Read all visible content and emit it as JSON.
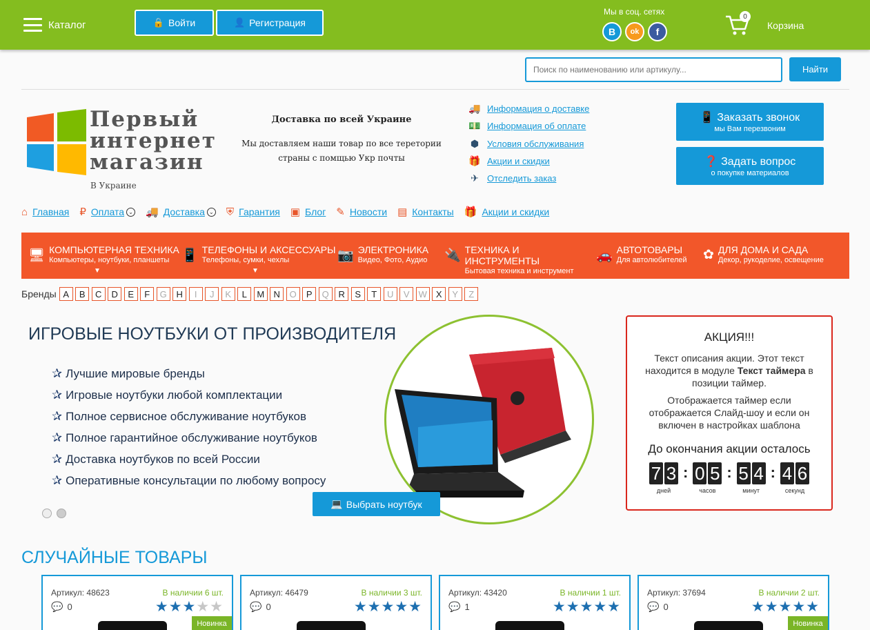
{
  "header": {
    "catalog_label": "Каталог",
    "login_label": "Войти",
    "register_label": "Регистрация",
    "social_label": "Мы в соц. сетях",
    "social": [
      {
        "name": "vk",
        "glyph": "B",
        "color": "#1599d8"
      },
      {
        "name": "ok",
        "glyph": "ok",
        "color": "#f79a1e"
      },
      {
        "name": "facebook",
        "glyph": "f",
        "color": "#3b5ba0"
      }
    ],
    "cart_count": "0",
    "cart_label": "Корзина"
  },
  "search": {
    "placeholder": "Поиск по наименованию или артикулу...",
    "button_label": "Найти"
  },
  "logo": {
    "line1": "Первый",
    "line2": "интернет",
    "line3": "магазин",
    "sub": "В Украине"
  },
  "delivery": {
    "title": "Доставка по всей Украине",
    "text": "Мы доставляем наши товар по все теретории страны с помщью Укр почты"
  },
  "info_links": [
    {
      "label": "Информация о доставке",
      "icon": "truck-icon"
    },
    {
      "label": "Информация об оплате",
      "icon": "money-icon"
    },
    {
      "label": "Условия обслуживания",
      "icon": "badge-icon"
    },
    {
      "label": "Акции и скидки",
      "icon": "gift-icon"
    },
    {
      "label": "Отследить заказ",
      "icon": "plane-icon"
    }
  ],
  "cta": {
    "call_title": "Заказать звонок",
    "call_sub": "мы Вам перезвоним",
    "ask_title": "Задать вопрос",
    "ask_sub": "о покупке материалов"
  },
  "nav": [
    {
      "label": "Главная",
      "icon": "home-icon"
    },
    {
      "label": "Оплата",
      "icon": "ruble-icon"
    },
    {
      "label": "Доставка",
      "icon": "truck-icon"
    },
    {
      "label": "Гарантия",
      "icon": "shield-icon"
    },
    {
      "label": "Блог",
      "icon": "blog-icon"
    },
    {
      "label": "Новости",
      "icon": "news-icon"
    },
    {
      "label": "Контакты",
      "icon": "contacts-icon"
    },
    {
      "label": "Акции и скидки",
      "icon": "gift-icon"
    }
  ],
  "categories": [
    {
      "name": "КОМПЬЮТЕРНАЯ ТЕХНИКА",
      "sub": "Компьютеры, ноутбуки, планшеты",
      "icon": "monitor-icon"
    },
    {
      "name": "ТЕЛЕФОНЫ И АКСЕССУАРЫ",
      "sub": "Телефоны, сумки, чехлы",
      "icon": "phone-icon"
    },
    {
      "name": "ЭЛЕКТРОНИКА",
      "sub": "Видео, Фото, Аудио",
      "icon": "camera-icon"
    },
    {
      "name": "ТЕХНИКА И ИНСТРУМЕНТЫ",
      "sub": "Бытовая техника и инструмент",
      "icon": "appliance-icon"
    },
    {
      "name": "АВТОТОВАРЫ",
      "sub": "Для автолюбителей",
      "icon": "car-icon"
    },
    {
      "name": "ДЛЯ ДОМА И САДА",
      "sub": "Декор, рукоделие, освещение",
      "icon": "flower-icon"
    }
  ],
  "brands": {
    "label": "Бренды",
    "letters": [
      "A",
      "B",
      "C",
      "D",
      "E",
      "F",
      "G",
      "H",
      "I",
      "J",
      "K",
      "L",
      "M",
      "N",
      "O",
      "P",
      "Q",
      "R",
      "S",
      "T",
      "U",
      "V",
      "W",
      "X",
      "Y",
      "Z"
    ],
    "active": [
      "A",
      "B",
      "C",
      "D",
      "E",
      "F",
      "H",
      "L",
      "M",
      "N",
      "P",
      "R",
      "S",
      "T",
      "X"
    ]
  },
  "slider": {
    "title": "ИГРОВЫЕ НОУТБУКИ ОТ ПРОИЗВОДИТЕЛЯ",
    "bullets": [
      "Лучшие мировые бренды",
      "Игровые ноутбуки любой комплектации",
      "Полное сервисное обслуживание ноутбуков",
      "Полное гарантийное обслуживание ноутбуков",
      "Доставка ноутбуков по всей России",
      "Оперативные консультации по любому вопросу"
    ],
    "button_label": "Выбрать ноутбук"
  },
  "promo": {
    "title": "АКЦИЯ!!!",
    "text_before": "Текст описания акции. Этот текст находится в модуле ",
    "text_bold": "Текст таймера",
    "text_after": " в позиции таймер.",
    "text2": "Отображается таймер если отображается Слайд-шоу и если он включен в настройках шаблона",
    "until": "До окончания акции осталось",
    "timer": [
      {
        "value": "73",
        "label": "дней"
      },
      {
        "value": "05",
        "label": "часов"
      },
      {
        "value": "54",
        "label": "минут"
      },
      {
        "value": "46",
        "label": "секунд"
      }
    ]
  },
  "random": {
    "title": "СЛУЧАЙНЫЕ ТОВАРЫ",
    "products": [
      {
        "article": "Артикул: 48623",
        "stock": "В наличии 6 шт.",
        "comments": "0",
        "rating": 3,
        "badge": "Новинка"
      },
      {
        "article": "Артикул: 46479",
        "stock": "В наличии 3 шт.",
        "comments": "0",
        "rating": 5,
        "badge": ""
      },
      {
        "article": "Артикул: 43420",
        "stock": "В наличии 1 шт.",
        "comments": "1",
        "rating": 5,
        "badge": ""
      },
      {
        "article": "Артикул: 37694",
        "stock": "В наличии 2 шт.",
        "comments": "0",
        "rating": 5,
        "badge": "Новинка"
      }
    ]
  }
}
